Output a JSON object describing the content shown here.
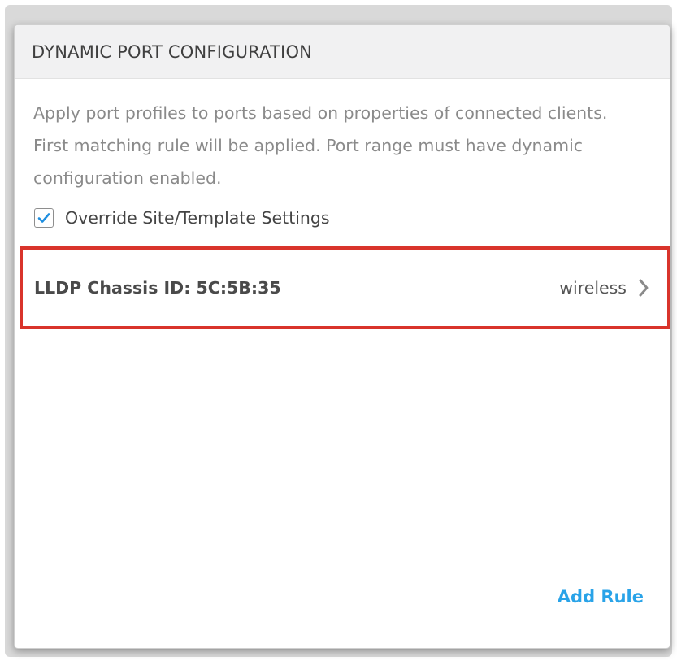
{
  "panel": {
    "title": "DYNAMIC PORT CONFIGURATION",
    "description": "Apply port profiles to ports based on properties of connected clients. First matching rule will be applied. Port range must have dynamic configuration enabled."
  },
  "override": {
    "label": "Override Site/Template Settings",
    "checked": true
  },
  "rules": [
    {
      "name": "LLDP Chassis ID: 5C:5B:35",
      "profile": "wireless"
    }
  ],
  "actions": {
    "add_rule_label": "Add Rule"
  },
  "colors": {
    "accent": "#29a3e8",
    "highlight_border": "#d9342b",
    "checkbox_check": "#1f8fe0"
  }
}
